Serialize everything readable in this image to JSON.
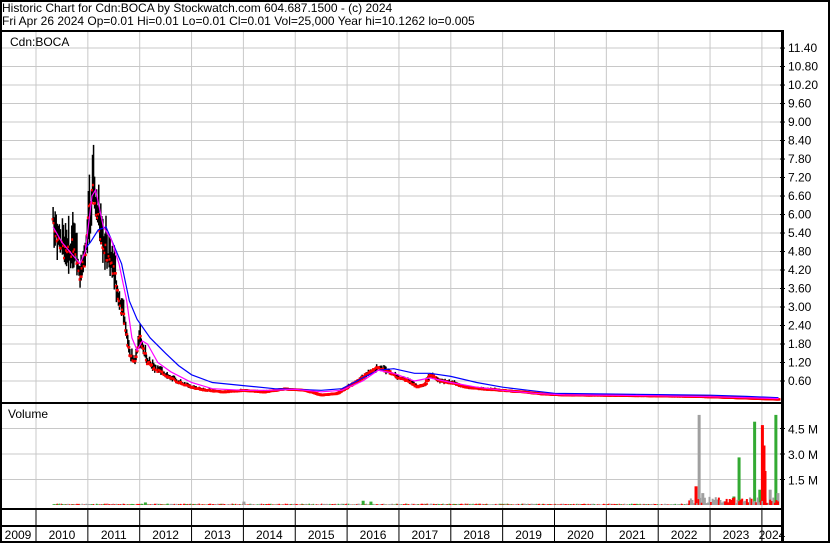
{
  "header": {
    "title": "Historic Chart for Cdn:BOCA by Stockwatch.com 604.687.1500 - (c) 2024",
    "quote": "Fri Apr 26 2024  Op=0.01  Hi=0.01  Lo=0.01  Cl=0.01  Vol=25,000  Year hi=10.1262  lo=0.005"
  },
  "chart_data": {
    "type": "line",
    "symbol": "Cdn:BOCA",
    "volume_label": "Volume",
    "price_ticks": [
      "0.60",
      "1.20",
      "1.80",
      "2.40",
      "3.00",
      "3.60",
      "4.20",
      "4.80",
      "5.40",
      "6.00",
      "6.60",
      "7.20",
      "7.80",
      "8.40",
      "9.00",
      "9.60",
      "10.20",
      "10.80",
      "11.40"
    ],
    "volume_ticks": [
      {
        "value": 1500000,
        "label": "1.5 M"
      },
      {
        "value": 3000000,
        "label": "3.0 M"
      },
      {
        "value": 4500000,
        "label": "4.5 M"
      }
    ],
    "years": [
      "2009",
      "2010",
      "2011",
      "2012",
      "2013",
      "2014",
      "2015",
      "2016",
      "2017",
      "2018",
      "2019",
      "2020",
      "2021",
      "2022",
      "2023",
      "2024"
    ],
    "ylim": [
      0,
      11.7
    ],
    "colors": {
      "close": "#ff0000",
      "bars": "#000000",
      "ma_short": "#ff00ff",
      "ma_long": "#0000ff",
      "vol_up": "#33aa33",
      "vol_down": "#ff0000",
      "vol_flat": "#a0a0a0",
      "grid": "#c8c8c8"
    },
    "close": [
      [
        2010.33,
        5.8
      ],
      [
        2010.42,
        5.2
      ],
      [
        2010.5,
        4.9
      ],
      [
        2010.6,
        4.6
      ],
      [
        2010.75,
        5.0
      ],
      [
        2010.85,
        4.0
      ],
      [
        2010.95,
        4.6
      ],
      [
        2011.05,
        6.3
      ],
      [
        2011.12,
        6.6
      ],
      [
        2011.2,
        5.8
      ],
      [
        2011.3,
        5.0
      ],
      [
        2011.4,
        4.5
      ],
      [
        2011.5,
        4.2
      ],
      [
        2011.6,
        3.2
      ],
      [
        2011.7,
        2.6
      ],
      [
        2011.8,
        1.5
      ],
      [
        2011.9,
        1.2
      ],
      [
        2012.0,
        2.0
      ],
      [
        2012.15,
        1.2
      ],
      [
        2012.3,
        1.0
      ],
      [
        2012.5,
        0.8
      ],
      [
        2012.7,
        0.6
      ],
      [
        2013.0,
        0.4
      ],
      [
        2013.3,
        0.3
      ],
      [
        2013.6,
        0.25
      ],
      [
        2014.0,
        0.3
      ],
      [
        2014.4,
        0.25
      ],
      [
        2014.8,
        0.35
      ],
      [
        2015.2,
        0.3
      ],
      [
        2015.5,
        0.15
      ],
      [
        2015.8,
        0.2
      ],
      [
        2016.0,
        0.4
      ],
      [
        2016.2,
        0.6
      ],
      [
        2016.4,
        0.85
      ],
      [
        2016.6,
        1.05
      ],
      [
        2016.8,
        0.9
      ],
      [
        2017.0,
        0.7
      ],
      [
        2017.2,
        0.6
      ],
      [
        2017.35,
        0.4
      ],
      [
        2017.5,
        0.5
      ],
      [
        2017.6,
        0.8
      ],
      [
        2017.8,
        0.6
      ],
      [
        2018.0,
        0.55
      ],
      [
        2018.3,
        0.4
      ],
      [
        2018.6,
        0.35
      ],
      [
        2019.0,
        0.3
      ],
      [
        2019.4,
        0.25
      ],
      [
        2019.8,
        0.18
      ],
      [
        2020.2,
        0.15
      ],
      [
        2021.0,
        0.14
      ],
      [
        2022.0,
        0.12
      ],
      [
        2022.8,
        0.1
      ],
      [
        2023.5,
        0.06
      ],
      [
        2024.32,
        0.01
      ]
    ],
    "ma_short": [
      [
        2010.33,
        5.6
      ],
      [
        2010.5,
        5.1
      ],
      [
        2010.7,
        4.7
      ],
      [
        2010.85,
        4.4
      ],
      [
        2010.95,
        4.8
      ],
      [
        2011.08,
        6.6
      ],
      [
        2011.15,
        6.8
      ],
      [
        2011.3,
        5.6
      ],
      [
        2011.45,
        5.2
      ],
      [
        2011.6,
        4.4
      ],
      [
        2011.75,
        3.2
      ],
      [
        2011.85,
        2.0
      ],
      [
        2011.95,
        1.6
      ],
      [
        2012.05,
        1.9
      ],
      [
        2012.15,
        1.8
      ],
      [
        2012.35,
        1.2
      ],
      [
        2012.6,
        0.9
      ],
      [
        2013.0,
        0.55
      ],
      [
        2013.4,
        0.35
      ],
      [
        2014.0,
        0.3
      ],
      [
        2014.5,
        0.3
      ],
      [
        2015.0,
        0.33
      ],
      [
        2015.5,
        0.25
      ],
      [
        2015.9,
        0.3
      ],
      [
        2016.3,
        0.6
      ],
      [
        2016.6,
        0.95
      ],
      [
        2016.9,
        0.85
      ],
      [
        2017.3,
        0.6
      ],
      [
        2017.6,
        0.7
      ],
      [
        2018.0,
        0.55
      ],
      [
        2018.5,
        0.4
      ],
      [
        2019.0,
        0.3
      ],
      [
        2019.6,
        0.2
      ],
      [
        2020.2,
        0.15
      ],
      [
        2021.0,
        0.14
      ],
      [
        2022.0,
        0.12
      ],
      [
        2023.0,
        0.09
      ],
      [
        2024.32,
        0.03
      ]
    ],
    "ma_long": [
      [
        2010.95,
        4.9
      ],
      [
        2011.05,
        5.1
      ],
      [
        2011.2,
        5.5
      ],
      [
        2011.35,
        5.6
      ],
      [
        2011.5,
        5.0
      ],
      [
        2011.65,
        4.4
      ],
      [
        2011.8,
        3.2
      ],
      [
        2011.95,
        2.6
      ],
      [
        2012.2,
        2.0
      ],
      [
        2012.5,
        1.5
      ],
      [
        2012.75,
        1.1
      ],
      [
        2013.0,
        0.8
      ],
      [
        2013.4,
        0.55
      ],
      [
        2014.0,
        0.45
      ],
      [
        2014.6,
        0.35
      ],
      [
        2015.0,
        0.33
      ],
      [
        2015.5,
        0.3
      ],
      [
        2015.9,
        0.35
      ],
      [
        2016.3,
        0.7
      ],
      [
        2016.6,
        0.95
      ],
      [
        2016.9,
        1.0
      ],
      [
        2017.3,
        0.85
      ],
      [
        2017.6,
        0.85
      ],
      [
        2018.0,
        0.75
      ],
      [
        2018.5,
        0.55
      ],
      [
        2019.0,
        0.4
      ],
      [
        2019.5,
        0.3
      ],
      [
        2020.0,
        0.2
      ],
      [
        2021.0,
        0.18
      ],
      [
        2022.0,
        0.16
      ],
      [
        2023.0,
        0.14
      ],
      [
        2023.7,
        0.1
      ],
      [
        2024.32,
        0.06
      ]
    ],
    "volume_spikes": [
      {
        "x": 2022.78,
        "v": 5300000,
        "dir": "flat"
      },
      {
        "x": 2022.72,
        "v": 1100000,
        "dir": "down"
      },
      {
        "x": 2022.85,
        "v": 700000,
        "dir": "flat"
      },
      {
        "x": 2023.55,
        "v": 2800000,
        "dir": "up"
      },
      {
        "x": 2023.45,
        "v": 500000,
        "dir": "up"
      },
      {
        "x": 2023.85,
        "v": 4900000,
        "dir": "up"
      },
      {
        "x": 2023.95,
        "v": 900000,
        "dir": "up"
      },
      {
        "x": 2024.0,
        "v": 4700000,
        "dir": "down"
      },
      {
        "x": 2024.03,
        "v": 3500000,
        "dir": "down"
      },
      {
        "x": 2024.05,
        "v": 2000000,
        "dir": "down"
      },
      {
        "x": 2024.15,
        "v": 900000,
        "dir": "flat"
      },
      {
        "x": 2024.26,
        "v": 5300000,
        "dir": "up"
      },
      {
        "x": 2024.3,
        "v": 700000,
        "dir": "flat"
      },
      {
        "x": 2016.3,
        "v": 250000,
        "dir": "up"
      },
      {
        "x": 2016.45,
        "v": 200000,
        "dir": "up"
      },
      {
        "x": 2014.0,
        "v": 200000,
        "dir": "flat"
      },
      {
        "x": 2012.1,
        "v": 150000,
        "dir": "up"
      }
    ]
  }
}
